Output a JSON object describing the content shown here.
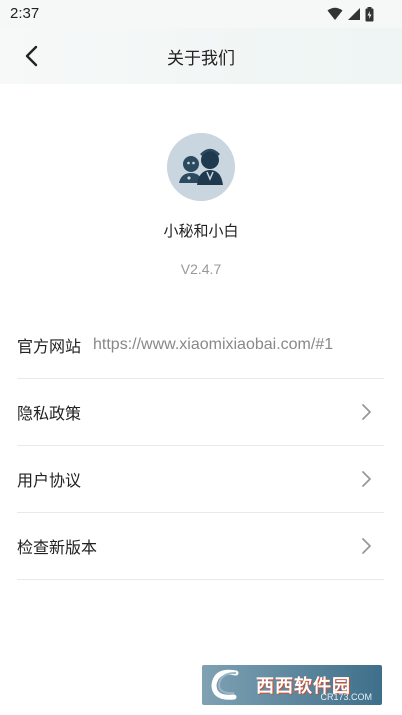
{
  "status_bar": {
    "time": "2:37",
    "icons": [
      "wifi-icon",
      "signal-icon",
      "battery-icon"
    ]
  },
  "header": {
    "title": "关于我们",
    "back_icon": "chevron-left-icon"
  },
  "app": {
    "name": "小秘和小白",
    "version": "V2.4.7"
  },
  "list": {
    "items": [
      {
        "label": "官方网站",
        "value": "https://www.xiaomixiaobai.com/#1"
      },
      {
        "label": "隐私政策",
        "icon": "chevron-right-icon"
      },
      {
        "label": "用户协议",
        "icon": "chevron-right-icon"
      },
      {
        "label": "检查新版本",
        "icon": "chevron-right-icon"
      }
    ]
  },
  "watermark": {
    "text": "西西软件园",
    "sub": "CR173.COM"
  },
  "colors": {
    "accent_bg": "#f1f6f5",
    "divider": "#e9e9e9",
    "secondary_text": "#999999",
    "avatar_bg": "#c9d6df"
  }
}
